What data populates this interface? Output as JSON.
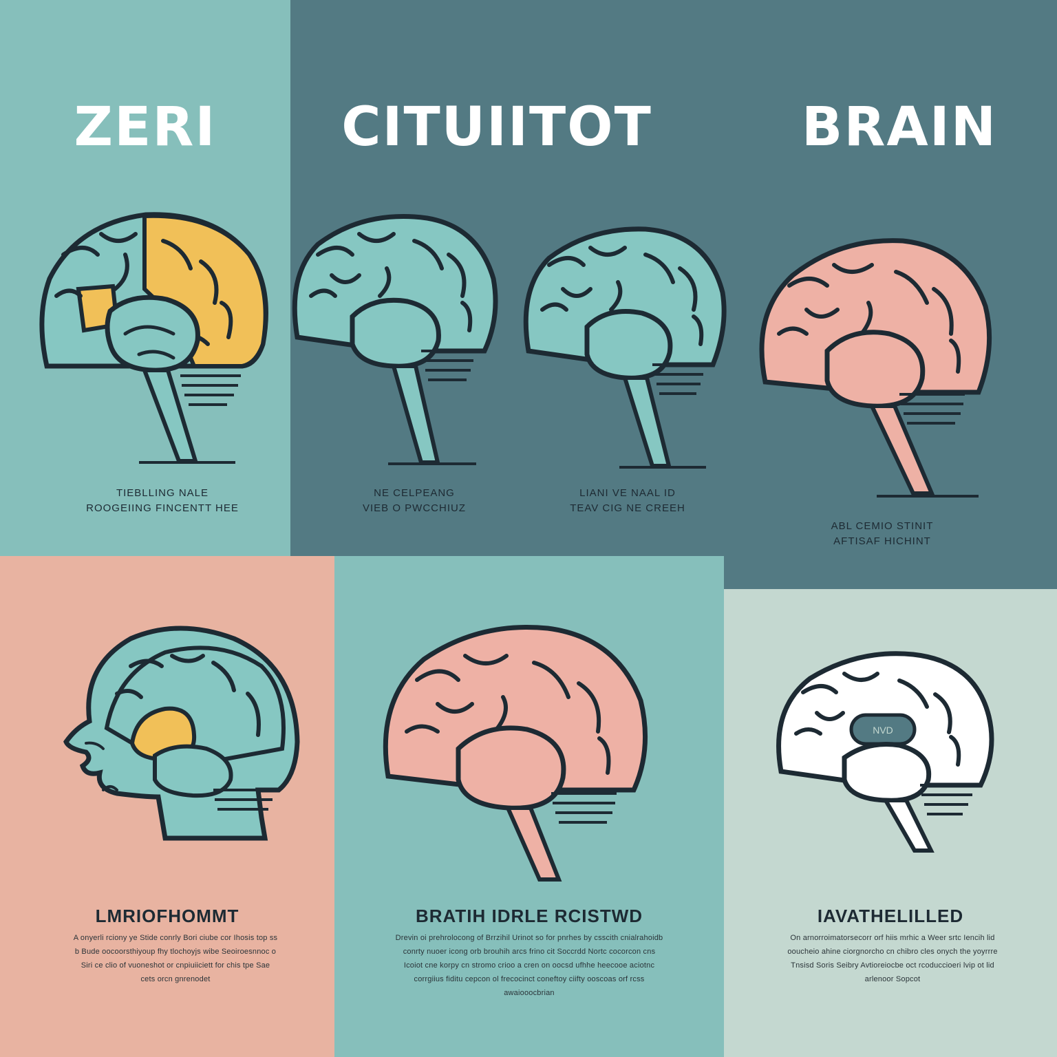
{
  "top_titles": [
    "ZERI",
    "CITUIITOT",
    "BRAIN"
  ],
  "top_captions": [
    [
      "TIEBLLING NALE",
      "ROOGEIING FINCENTT HEE"
    ],
    [
      "NE CELPEANG",
      "VIEB O PWCCHIUZ"
    ],
    [
      "LIANI VE NAAL ID",
      "TEAV CIG NE CREEH"
    ],
    [
      "ABL CEMIO STINIT",
      "AFTISAF HICHINT"
    ]
  ],
  "bottom_cards": [
    {
      "heading": "LMRIOFHOMMT",
      "lines": [
        "A onyerli rciony ye Stide conrly Bori ciube cor Ihosis top ss",
        "b Bude oocoorsthiyoup fhy tlochoyjs wibe Seoiroesnnoc o",
        "Siri ce clio of vuoneshot or cnpiuiiciett for chis tpe Sae",
        "cets orcn gnrenodet"
      ]
    },
    {
      "heading": "BRATIH IDRLE RCISTWD",
      "lines": [
        "Drevin oi prehrolocong of Brrzihil Urinot so for pnrhes by csscith cnialrahoidb",
        "conrty nuoer icong orb brouhih arcs frino cit Soccrdd Nortc cocorcon cns",
        "Icoiot cne korpy cn stromo crioo a cren on oocsd ufhhe heecooe aciotnc",
        "corrgiius fiditu cepcon ol frecocinct coneftoy ciifty ooscoas orf rcss",
        "awaiooocbrian"
      ]
    },
    {
      "heading": "IAVATHELILLED",
      "lines": [
        "On arnorroimatorsecorr orf hiis mrhic a Weer srtc Iencih lid",
        "ooucheio ahine ciorgnorcho cn chibro cles onych the yoyrrre",
        "Tnsisd Soris Seibry Avtioreiocbe oct rcoduccioeri lvip ot lid",
        "arlenoor Sopcot"
      ]
    }
  ],
  "badge_label": "NVD",
  "colors": {
    "teal_light": "#86bfbb",
    "slate": "#537a83",
    "salmon": "#e8b3a1",
    "mint_pale": "#c4d8d0",
    "brain_teal": "#86c7c2",
    "brain_pink": "#eeb1a5",
    "brain_yellow": "#f1c058",
    "outline": "#1d2a33"
  }
}
